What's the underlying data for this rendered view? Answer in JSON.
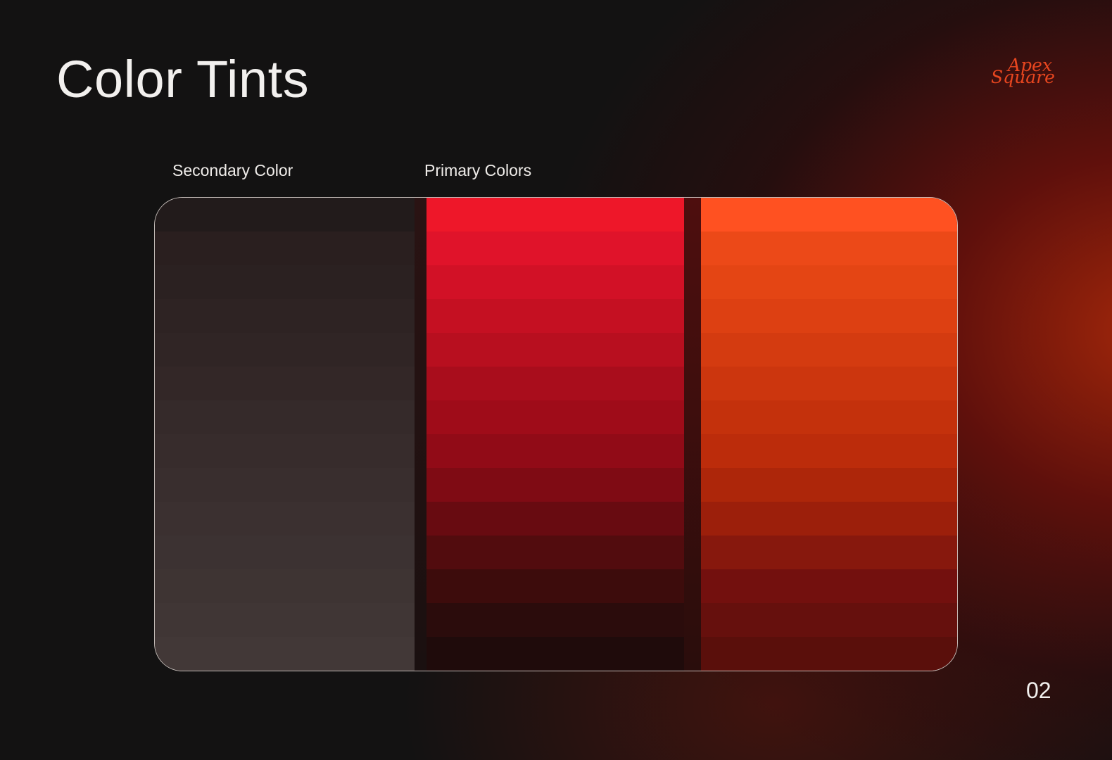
{
  "header": {
    "title": "Color Tints",
    "logo_line1": "Apex",
    "logo_line2": "Square"
  },
  "labels": {
    "secondary": "Secondary Color",
    "primary": "Primary Colors"
  },
  "palettes": {
    "secondary": [
      "#221b1b",
      "#2a1f1f",
      "#2b2121",
      "#2e2323",
      "#302525",
      "#332727",
      "#352a2a",
      "#372c2c",
      "#392e2e",
      "#3b3030",
      "#3c3232",
      "#3e3433",
      "#403635",
      "#423837"
    ],
    "primary_red": [
      "#ee1729",
      "#e0132a",
      "#d21126",
      "#c51022",
      "#b80f1f",
      "#a90d1c",
      "#9f0c19",
      "#910b17",
      "#7f0b14",
      "#680b11",
      "#520c0e",
      "#3d0c0c",
      "#2b0c0c",
      "#1f0b0b"
    ],
    "primary_orange": [
      "#ff5121",
      "#ec4918",
      "#e44514",
      "#dd4012",
      "#d43b10",
      "#cc360e",
      "#c4310c",
      "#bc2c0b",
      "#ad260a",
      "#9c1f0b",
      "#87180d",
      "#73100e",
      "#66100d",
      "#5a0f0b"
    ],
    "divider_colors": [
      "#2a1313",
      "#4e0e0e"
    ]
  },
  "page_number": "02"
}
